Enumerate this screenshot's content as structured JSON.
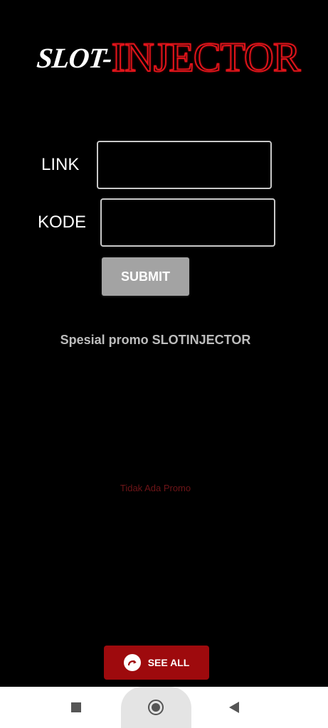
{
  "logo": {
    "part1": "SLOT-",
    "part2": "INJECTOR"
  },
  "form": {
    "link_label": "LINK",
    "link_value": "",
    "kode_label": "KODE",
    "kode_value": "",
    "submit_label": "SUBMIT"
  },
  "promo": {
    "title": "Spesial promo SLOTINJECTOR",
    "empty_text": "Tidak Ada Promo"
  },
  "see_all": {
    "label": "SEE ALL",
    "icon": "redo-arrow-icon"
  },
  "navbar": {
    "recents_icon": "square-icon",
    "home_icon": "home-circle-icon",
    "back_icon": "back-triangle-icon"
  },
  "colors": {
    "background": "#000000",
    "logo_red": "#e0141a",
    "submit_bg": "#a3a3a3",
    "see_all_bg": "#9e0a0d",
    "promo_empty": "#6e1518"
  }
}
